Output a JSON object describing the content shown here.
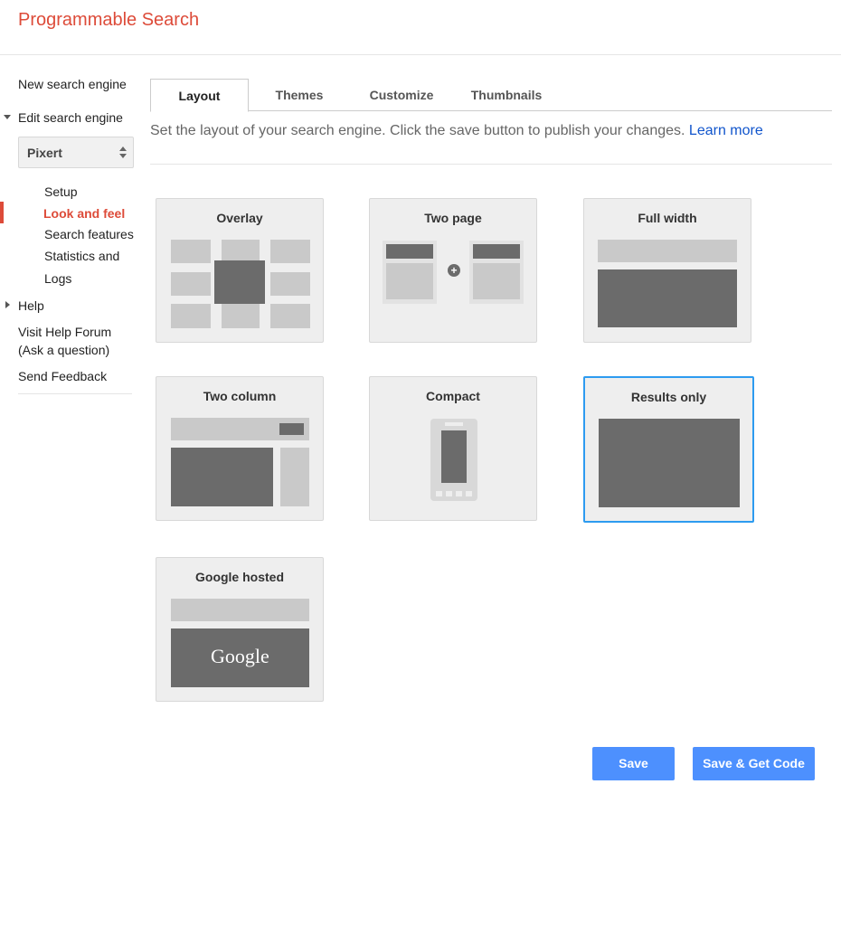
{
  "app": {
    "title": "Programmable Search"
  },
  "sidebar": {
    "new_engine": "New search engine",
    "edit_engine": "Edit search engine",
    "engine_select": {
      "selected": "Pixert"
    },
    "sub_items": [
      "Setup",
      "Look and feel",
      "Search features",
      "Statistics and",
      "Logs"
    ],
    "active_item": "Look and feel",
    "help": "Help",
    "help_forum_line1": "Visit Help Forum",
    "help_forum_line2": "(Ask a question)",
    "feedback": "Send Feedback"
  },
  "tabs": [
    {
      "label": "Layout",
      "active": true
    },
    {
      "label": "Themes"
    },
    {
      "label": "Customize"
    },
    {
      "label": "Thumbnails"
    }
  ],
  "description": {
    "text": "Set the layout of your search engine. Click the save button to publish your changes.",
    "link": "Learn more"
  },
  "layouts": [
    {
      "title": "Overlay"
    },
    {
      "title": "Two page"
    },
    {
      "title": "Full width"
    },
    {
      "title": "Two column"
    },
    {
      "title": "Compact"
    },
    {
      "title": "Results only",
      "selected": true
    },
    {
      "title": "Google hosted",
      "logo_text": "Google"
    }
  ],
  "buttons": {
    "save": "Save",
    "save_get_code": "Save & Get Code"
  },
  "colors": {
    "brand": "#dd4b39",
    "accent": "#4d90fe",
    "link": "#1155cc",
    "selection": "#2d9bf0"
  }
}
